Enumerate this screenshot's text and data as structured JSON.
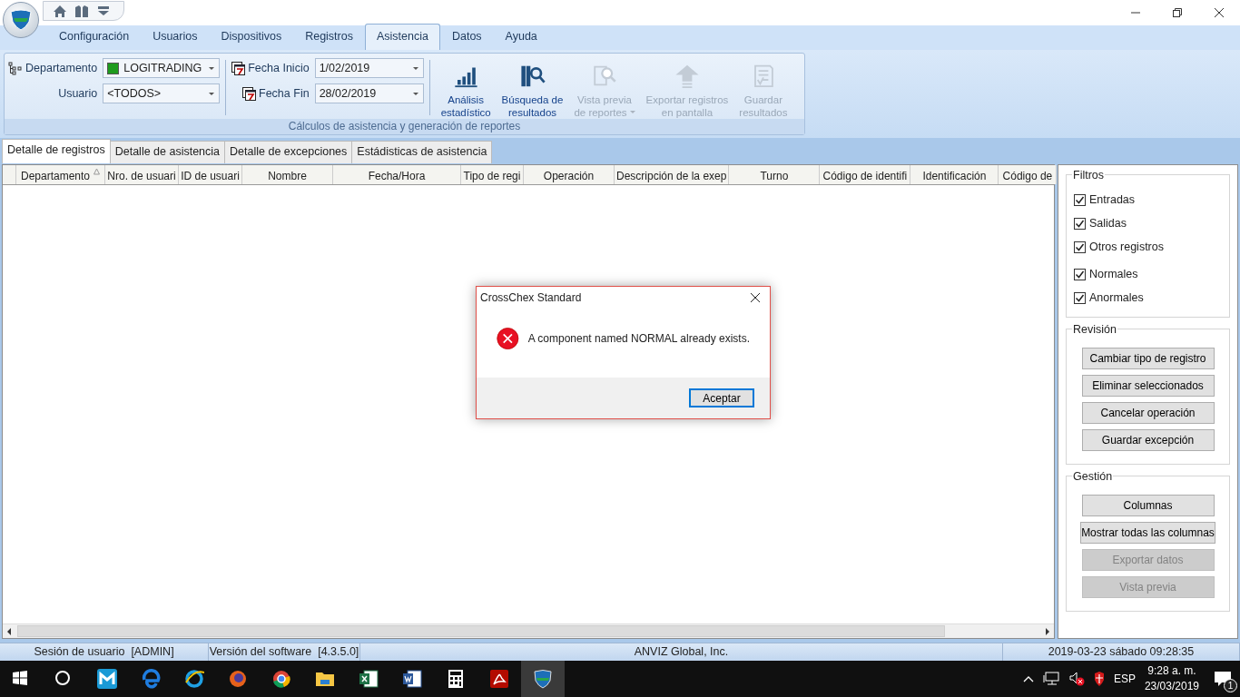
{
  "menu_tabs": [
    {
      "label": "Configuración",
      "selected": false
    },
    {
      "label": "Usuarios",
      "selected": false
    },
    {
      "label": "Dispositivos",
      "selected": false
    },
    {
      "label": "Registros",
      "selected": false
    },
    {
      "label": "Asistencia",
      "selected": true
    },
    {
      "label": "Datos",
      "selected": false
    },
    {
      "label": "Ayuda",
      "selected": false
    }
  ],
  "ribbon": {
    "department": {
      "label": "Departamento",
      "value": "LOGITRADING",
      "color": "#1e9b1e"
    },
    "user": {
      "label": "Usuario",
      "value": "<TODOS>"
    },
    "start_date": {
      "label": "Fecha Inicio",
      "value": "1/02/2019"
    },
    "end_date": {
      "label": "Fecha Fin",
      "value": "28/02/2019"
    },
    "actions": [
      {
        "kind": "chart",
        "lines": [
          "Análisis",
          "estadístico"
        ],
        "disabled": false,
        "dropdown": false
      },
      {
        "kind": "search",
        "lines": [
          "Búsqueda de",
          "resultados"
        ],
        "disabled": false,
        "dropdown": false
      },
      {
        "kind": "preview",
        "lines": [
          "Vista previa",
          "de reportes"
        ],
        "disabled": true,
        "dropdown": true
      },
      {
        "kind": "export",
        "lines": [
          "Exportar registros",
          "en pantalla"
        ],
        "disabled": true,
        "dropdown": false
      },
      {
        "kind": "save",
        "lines": [
          "Guardar",
          "resultados"
        ],
        "disabled": true,
        "dropdown": false
      }
    ],
    "group_label": "Cálculos de asistencia y generación de reportes"
  },
  "view_tabs": [
    {
      "label": "Detalle de registros",
      "selected": true
    },
    {
      "label": "Detalle de asistencia",
      "selected": false
    },
    {
      "label": "Detalle de excepciones",
      "selected": false
    },
    {
      "label": "Estádisticas de asistencia",
      "selected": false
    }
  ],
  "table": {
    "columns": [
      {
        "label": "Departamento",
        "sorted": true
      },
      {
        "label": "Nro. de usuari",
        "sorted": false
      },
      {
        "label": "ID de usuari",
        "sorted": false
      },
      {
        "label": "Nombre",
        "sorted": false
      },
      {
        "label": "Fecha/Hora",
        "sorted": false
      },
      {
        "label": "Tipo de regi",
        "sorted": false
      },
      {
        "label": "Operación",
        "sorted": false
      },
      {
        "label": "Descripción de la exep",
        "sorted": false
      },
      {
        "label": "Turno",
        "sorted": false
      },
      {
        "label": "Código de identifi",
        "sorted": false
      },
      {
        "label": "Identificación",
        "sorted": false
      },
      {
        "label": "Código de",
        "sorted": false
      }
    ]
  },
  "filters": {
    "title": "Filtros",
    "items": [
      {
        "label": "Entradas",
        "checked": true
      },
      {
        "label": "Salidas",
        "checked": true
      },
      {
        "label": "Otros registros",
        "checked": true
      },
      {
        "label": "Normales",
        "checked": true
      },
      {
        "label": "Anormales",
        "checked": true
      }
    ]
  },
  "revision": {
    "title": "Revisión",
    "buttons": [
      {
        "label": "Cambiar tipo de registro",
        "disabled": false
      },
      {
        "label": "Eliminar seleccionados",
        "disabled": false
      },
      {
        "label": "Cancelar operación",
        "disabled": false
      },
      {
        "label": "Guardar excepción",
        "disabled": false
      }
    ]
  },
  "management": {
    "title": "Gestión",
    "buttons": [
      {
        "label": "Columnas",
        "disabled": false
      },
      {
        "label": "Mostrar todas las columnas",
        "disabled": false
      },
      {
        "label": "Exportar datos",
        "disabled": true
      },
      {
        "label": "Vista previa",
        "disabled": true
      }
    ]
  },
  "status_bar": [
    "Sesión de usuario  [ADMIN]",
    "Versión del software  [4.3.5.0]",
    "ANVIZ Global, Inc.",
    "2019-03-23 sábado 09:28:35"
  ],
  "dialog": {
    "title": "CrossChex Standard",
    "message": "A component named NORMAL already exists.",
    "button": "Aceptar"
  },
  "taskbar": {
    "language": "ESP",
    "time": "9:28 a. m.",
    "date": "23/03/2019",
    "notifications": "1"
  }
}
